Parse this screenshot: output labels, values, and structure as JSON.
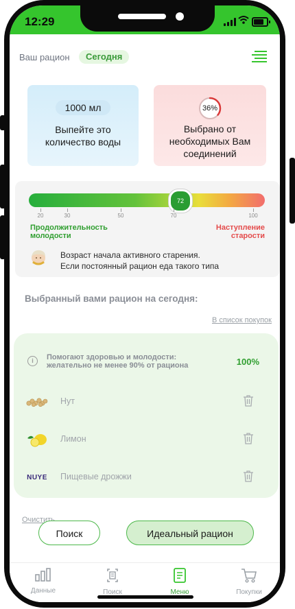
{
  "status_bar": {
    "time": "12:29"
  },
  "header": {
    "title": "Ваш рацион",
    "period_pill": "Сегодня",
    "menu_icon": "hamburger-menu-icon"
  },
  "water_card": {
    "value": "1000 мл",
    "text": "Выпейте это количество воды"
  },
  "selected_card": {
    "percent": "36%",
    "percent_value": 36,
    "text": "Выбрано от необходимых Вам соединений"
  },
  "youth_scale": {
    "marker_value": "72",
    "ticks": [
      "20",
      "30",
      "50",
      "70",
      "100"
    ],
    "legend_left": "Продолжительность молодости",
    "legend_right": "Наступление старости",
    "note_line1": "Возраст начала активного старения.",
    "note_line2": "Если постоянный рацион еда такого типа"
  },
  "section": {
    "title": "Выбранный вами рацион на сегодня:",
    "shopping_link": "В список покупок"
  },
  "food_list": {
    "info_line1": "Помогают здоровью и молодости:",
    "info_line2": "желательно не менее 90% от рациона",
    "percent": "100%",
    "items": [
      {
        "name": "Нут",
        "icon": "chickpea-icon"
      },
      {
        "name": "Лимон",
        "icon": "lemon-icon"
      },
      {
        "name": "Пищевые дрожжи",
        "icon": "nuye-brand-logo",
        "logo_text": "NUYE"
      }
    ]
  },
  "actions": {
    "clear": "Очистить",
    "search": "Поиск",
    "ideal": "Идеальный рацион"
  },
  "tabs": [
    {
      "label": "Данные",
      "icon": "bar-chart-icon"
    },
    {
      "label": "Поиск",
      "icon": "search-document-icon"
    },
    {
      "label": "Меню",
      "icon": "menu-document-icon",
      "active": true
    },
    {
      "label": "Покупки",
      "icon": "cart-icon"
    }
  ],
  "colors": {
    "accent": "#35c52d",
    "active_tab": "#3aa13a",
    "legend_red": "#e44b4b"
  }
}
